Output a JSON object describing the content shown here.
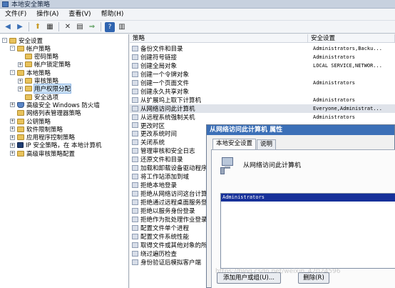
{
  "window": {
    "title": "本地安全策略"
  },
  "menu": [
    "文件(F)",
    "操作(A)",
    "查看(V)",
    "帮助(H)"
  ],
  "toolbar": [
    "back-icon",
    "forward-icon",
    "up-icon",
    "console-tree-icon",
    "delete-icon",
    "properties-icon",
    "export-icon",
    "help-icon",
    "view-icon"
  ],
  "tree": [
    {
      "label": "安全设置",
      "level": 0,
      "exp": "-",
      "icon": "folder"
    },
    {
      "label": "帐户策略",
      "level": 1,
      "exp": "-",
      "icon": "folder"
    },
    {
      "label": "密码策略",
      "level": 2,
      "exp": "",
      "icon": "folder"
    },
    {
      "label": "帐户锁定策略",
      "level": 2,
      "exp": "+",
      "icon": "folder"
    },
    {
      "label": "本地策略",
      "level": 1,
      "exp": "-",
      "icon": "folder"
    },
    {
      "label": "审核策略",
      "level": 2,
      "exp": "+",
      "icon": "folder"
    },
    {
      "label": "用户权限分配",
      "level": 2,
      "exp": "+",
      "icon": "folder",
      "selected": true
    },
    {
      "label": "安全选项",
      "level": 2,
      "exp": "",
      "icon": "folder"
    },
    {
      "label": "高级安全 Windows 防火墙",
      "level": 1,
      "exp": "+",
      "icon": "shield"
    },
    {
      "label": "网络列表管理器策略",
      "level": 1,
      "exp": "",
      "icon": "folder"
    },
    {
      "label": "公钥策略",
      "level": 1,
      "exp": "+",
      "icon": "folder"
    },
    {
      "label": "软件限制策略",
      "level": 1,
      "exp": "+",
      "icon": "folder"
    },
    {
      "label": "应用程序控制策略",
      "level": 1,
      "exp": "+",
      "icon": "folder"
    },
    {
      "label": "IP 安全策略，在 本地计算机",
      "level": 1,
      "exp": "+",
      "icon": "pc"
    },
    {
      "label": "高级审核策略配置",
      "level": 1,
      "exp": "+",
      "icon": "folder"
    }
  ],
  "columns": {
    "policy": "策略",
    "setting": "安全设置"
  },
  "policies": [
    {
      "name": "备份文件和目录",
      "setting": "Administrators,Backu..."
    },
    {
      "name": "创建符号链接",
      "setting": "Administrators"
    },
    {
      "name": "创建全局对象",
      "setting": "LOCAL SERVICE,NETWOR..."
    },
    {
      "name": "创建一个令牌对象",
      "setting": ""
    },
    {
      "name": "创建一个页面文件",
      "setting": "Administrators"
    },
    {
      "name": "创建永久共享对象",
      "setting": ""
    },
    {
      "name": "从扩展坞上取下计算机",
      "setting": "Administrators"
    },
    {
      "name": "从网络访问此计算机",
      "setting": "Everyone,Administrat...",
      "highlight": true
    },
    {
      "name": "从远程系统强制关机",
      "setting": "Administrators"
    },
    {
      "name": "更改时区",
      "setting": ""
    },
    {
      "name": "更改系统时间",
      "setting": ""
    },
    {
      "name": "关闭系统",
      "setting": ""
    },
    {
      "name": "管理审核和安全日志",
      "setting": ""
    },
    {
      "name": "还原文件和目录",
      "setting": ""
    },
    {
      "name": "加载和卸载设备驱动程序",
      "setting": ""
    },
    {
      "name": "将工作站添加到域",
      "setting": ""
    },
    {
      "name": "拒绝本地登录",
      "setting": ""
    },
    {
      "name": "拒绝从网络访问这台计算",
      "setting": ""
    },
    {
      "name": "拒绝通过远程桌面服务登",
      "setting": ""
    },
    {
      "name": "拒绝以服务身份登录",
      "setting": ""
    },
    {
      "name": "拒绝作为批处理作业登录",
      "setting": ""
    },
    {
      "name": "配置文件单个进程",
      "setting": ""
    },
    {
      "name": "配置文件系统性能",
      "setting": ""
    },
    {
      "name": "取得文件或其他对象的所",
      "setting": ""
    },
    {
      "name": "绕过遍历检查",
      "setting": ""
    },
    {
      "name": "身份验证后模拟客户端",
      "setting": ""
    }
  ],
  "dialog": {
    "title": "从网络访问此计算机 属性",
    "tabs": [
      "本地安全设置",
      "说明"
    ],
    "policy_name": "从网络访问此计算机",
    "accounts": [
      "Administrators"
    ],
    "add_button": "添加用户或组(U)...",
    "remove_button": "删除(R)"
  },
  "watermark": "https://blog.csdn.net/weixin_42024596"
}
